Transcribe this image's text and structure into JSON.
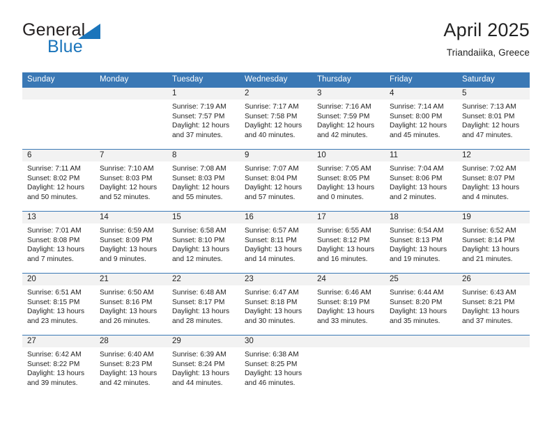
{
  "brand": {
    "line1": "General",
    "line2": "Blue",
    "triangle_color": "#1b75bb"
  },
  "header": {
    "title": "April 2025",
    "location": "Triandaiika, Greece"
  },
  "colors": {
    "header_blue": "#3a78b5",
    "row_band_gray": "#f2f2f2",
    "text": "#222222",
    "brand_blue": "#1b75bb"
  },
  "weekdays": [
    "Sunday",
    "Monday",
    "Tuesday",
    "Wednesday",
    "Thursday",
    "Friday",
    "Saturday"
  ],
  "weeks": [
    [
      {
        "day": "",
        "sunrise": "",
        "sunset": "",
        "daylight_line1": "",
        "daylight_line2": ""
      },
      {
        "day": "",
        "sunrise": "",
        "sunset": "",
        "daylight_line1": "",
        "daylight_line2": ""
      },
      {
        "day": "1",
        "sunrise": "Sunrise: 7:19 AM",
        "sunset": "Sunset: 7:57 PM",
        "daylight_line1": "Daylight: 12 hours",
        "daylight_line2": "and 37 minutes."
      },
      {
        "day": "2",
        "sunrise": "Sunrise: 7:17 AM",
        "sunset": "Sunset: 7:58 PM",
        "daylight_line1": "Daylight: 12 hours",
        "daylight_line2": "and 40 minutes."
      },
      {
        "day": "3",
        "sunrise": "Sunrise: 7:16 AM",
        "sunset": "Sunset: 7:59 PM",
        "daylight_line1": "Daylight: 12 hours",
        "daylight_line2": "and 42 minutes."
      },
      {
        "day": "4",
        "sunrise": "Sunrise: 7:14 AM",
        "sunset": "Sunset: 8:00 PM",
        "daylight_line1": "Daylight: 12 hours",
        "daylight_line2": "and 45 minutes."
      },
      {
        "day": "5",
        "sunrise": "Sunrise: 7:13 AM",
        "sunset": "Sunset: 8:01 PM",
        "daylight_line1": "Daylight: 12 hours",
        "daylight_line2": "and 47 minutes."
      }
    ],
    [
      {
        "day": "6",
        "sunrise": "Sunrise: 7:11 AM",
        "sunset": "Sunset: 8:02 PM",
        "daylight_line1": "Daylight: 12 hours",
        "daylight_line2": "and 50 minutes."
      },
      {
        "day": "7",
        "sunrise": "Sunrise: 7:10 AM",
        "sunset": "Sunset: 8:03 PM",
        "daylight_line1": "Daylight: 12 hours",
        "daylight_line2": "and 52 minutes."
      },
      {
        "day": "8",
        "sunrise": "Sunrise: 7:08 AM",
        "sunset": "Sunset: 8:03 PM",
        "daylight_line1": "Daylight: 12 hours",
        "daylight_line2": "and 55 minutes."
      },
      {
        "day": "9",
        "sunrise": "Sunrise: 7:07 AM",
        "sunset": "Sunset: 8:04 PM",
        "daylight_line1": "Daylight: 12 hours",
        "daylight_line2": "and 57 minutes."
      },
      {
        "day": "10",
        "sunrise": "Sunrise: 7:05 AM",
        "sunset": "Sunset: 8:05 PM",
        "daylight_line1": "Daylight: 13 hours",
        "daylight_line2": "and 0 minutes."
      },
      {
        "day": "11",
        "sunrise": "Sunrise: 7:04 AM",
        "sunset": "Sunset: 8:06 PM",
        "daylight_line1": "Daylight: 13 hours",
        "daylight_line2": "and 2 minutes."
      },
      {
        "day": "12",
        "sunrise": "Sunrise: 7:02 AM",
        "sunset": "Sunset: 8:07 PM",
        "daylight_line1": "Daylight: 13 hours",
        "daylight_line2": "and 4 minutes."
      }
    ],
    [
      {
        "day": "13",
        "sunrise": "Sunrise: 7:01 AM",
        "sunset": "Sunset: 8:08 PM",
        "daylight_line1": "Daylight: 13 hours",
        "daylight_line2": "and 7 minutes."
      },
      {
        "day": "14",
        "sunrise": "Sunrise: 6:59 AM",
        "sunset": "Sunset: 8:09 PM",
        "daylight_line1": "Daylight: 13 hours",
        "daylight_line2": "and 9 minutes."
      },
      {
        "day": "15",
        "sunrise": "Sunrise: 6:58 AM",
        "sunset": "Sunset: 8:10 PM",
        "daylight_line1": "Daylight: 13 hours",
        "daylight_line2": "and 12 minutes."
      },
      {
        "day": "16",
        "sunrise": "Sunrise: 6:57 AM",
        "sunset": "Sunset: 8:11 PM",
        "daylight_line1": "Daylight: 13 hours",
        "daylight_line2": "and 14 minutes."
      },
      {
        "day": "17",
        "sunrise": "Sunrise: 6:55 AM",
        "sunset": "Sunset: 8:12 PM",
        "daylight_line1": "Daylight: 13 hours",
        "daylight_line2": "and 16 minutes."
      },
      {
        "day": "18",
        "sunrise": "Sunrise: 6:54 AM",
        "sunset": "Sunset: 8:13 PM",
        "daylight_line1": "Daylight: 13 hours",
        "daylight_line2": "and 19 minutes."
      },
      {
        "day": "19",
        "sunrise": "Sunrise: 6:52 AM",
        "sunset": "Sunset: 8:14 PM",
        "daylight_line1": "Daylight: 13 hours",
        "daylight_line2": "and 21 minutes."
      }
    ],
    [
      {
        "day": "20",
        "sunrise": "Sunrise: 6:51 AM",
        "sunset": "Sunset: 8:15 PM",
        "daylight_line1": "Daylight: 13 hours",
        "daylight_line2": "and 23 minutes."
      },
      {
        "day": "21",
        "sunrise": "Sunrise: 6:50 AM",
        "sunset": "Sunset: 8:16 PM",
        "daylight_line1": "Daylight: 13 hours",
        "daylight_line2": "and 26 minutes."
      },
      {
        "day": "22",
        "sunrise": "Sunrise: 6:48 AM",
        "sunset": "Sunset: 8:17 PM",
        "daylight_line1": "Daylight: 13 hours",
        "daylight_line2": "and 28 minutes."
      },
      {
        "day": "23",
        "sunrise": "Sunrise: 6:47 AM",
        "sunset": "Sunset: 8:18 PM",
        "daylight_line1": "Daylight: 13 hours",
        "daylight_line2": "and 30 minutes."
      },
      {
        "day": "24",
        "sunrise": "Sunrise: 6:46 AM",
        "sunset": "Sunset: 8:19 PM",
        "daylight_line1": "Daylight: 13 hours",
        "daylight_line2": "and 33 minutes."
      },
      {
        "day": "25",
        "sunrise": "Sunrise: 6:44 AM",
        "sunset": "Sunset: 8:20 PM",
        "daylight_line1": "Daylight: 13 hours",
        "daylight_line2": "and 35 minutes."
      },
      {
        "day": "26",
        "sunrise": "Sunrise: 6:43 AM",
        "sunset": "Sunset: 8:21 PM",
        "daylight_line1": "Daylight: 13 hours",
        "daylight_line2": "and 37 minutes."
      }
    ],
    [
      {
        "day": "27",
        "sunrise": "Sunrise: 6:42 AM",
        "sunset": "Sunset: 8:22 PM",
        "daylight_line1": "Daylight: 13 hours",
        "daylight_line2": "and 39 minutes."
      },
      {
        "day": "28",
        "sunrise": "Sunrise: 6:40 AM",
        "sunset": "Sunset: 8:23 PM",
        "daylight_line1": "Daylight: 13 hours",
        "daylight_line2": "and 42 minutes."
      },
      {
        "day": "29",
        "sunrise": "Sunrise: 6:39 AM",
        "sunset": "Sunset: 8:24 PM",
        "daylight_line1": "Daylight: 13 hours",
        "daylight_line2": "and 44 minutes."
      },
      {
        "day": "30",
        "sunrise": "Sunrise: 6:38 AM",
        "sunset": "Sunset: 8:25 PM",
        "daylight_line1": "Daylight: 13 hours",
        "daylight_line2": "and 46 minutes."
      },
      {
        "day": "",
        "sunrise": "",
        "sunset": "",
        "daylight_line1": "",
        "daylight_line2": ""
      },
      {
        "day": "",
        "sunrise": "",
        "sunset": "",
        "daylight_line1": "",
        "daylight_line2": ""
      },
      {
        "day": "",
        "sunrise": "",
        "sunset": "",
        "daylight_line1": "",
        "daylight_line2": ""
      }
    ]
  ]
}
